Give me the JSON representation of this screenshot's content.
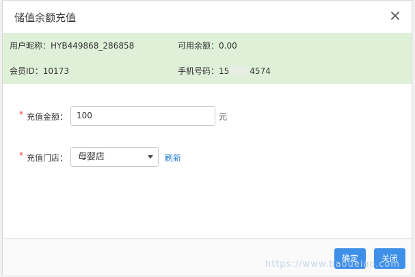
{
  "dialog": {
    "title": "储值余额充值",
    "close_icon": "close-icon"
  },
  "info": {
    "nickname_label": "用户昵称：",
    "nickname_value": "HYB449868_286858",
    "balance_label": "可用余额：",
    "balance_value": "0.00",
    "member_id_label": "会员ID：",
    "member_id_value": "10173",
    "phone_label": "手机号码：",
    "phone_prefix": "15",
    "phone_suffix": "4574"
  },
  "form": {
    "amount_label": "充值金额：",
    "amount_value": "100",
    "amount_unit": "元",
    "store_label": "充值门店：",
    "store_value": "母婴店",
    "refresh_link": "刷新",
    "required_mark": "*"
  },
  "footer": {
    "confirm_label": "确定",
    "close_label": "关闭"
  },
  "watermark": "https://www.baoueiao.com"
}
